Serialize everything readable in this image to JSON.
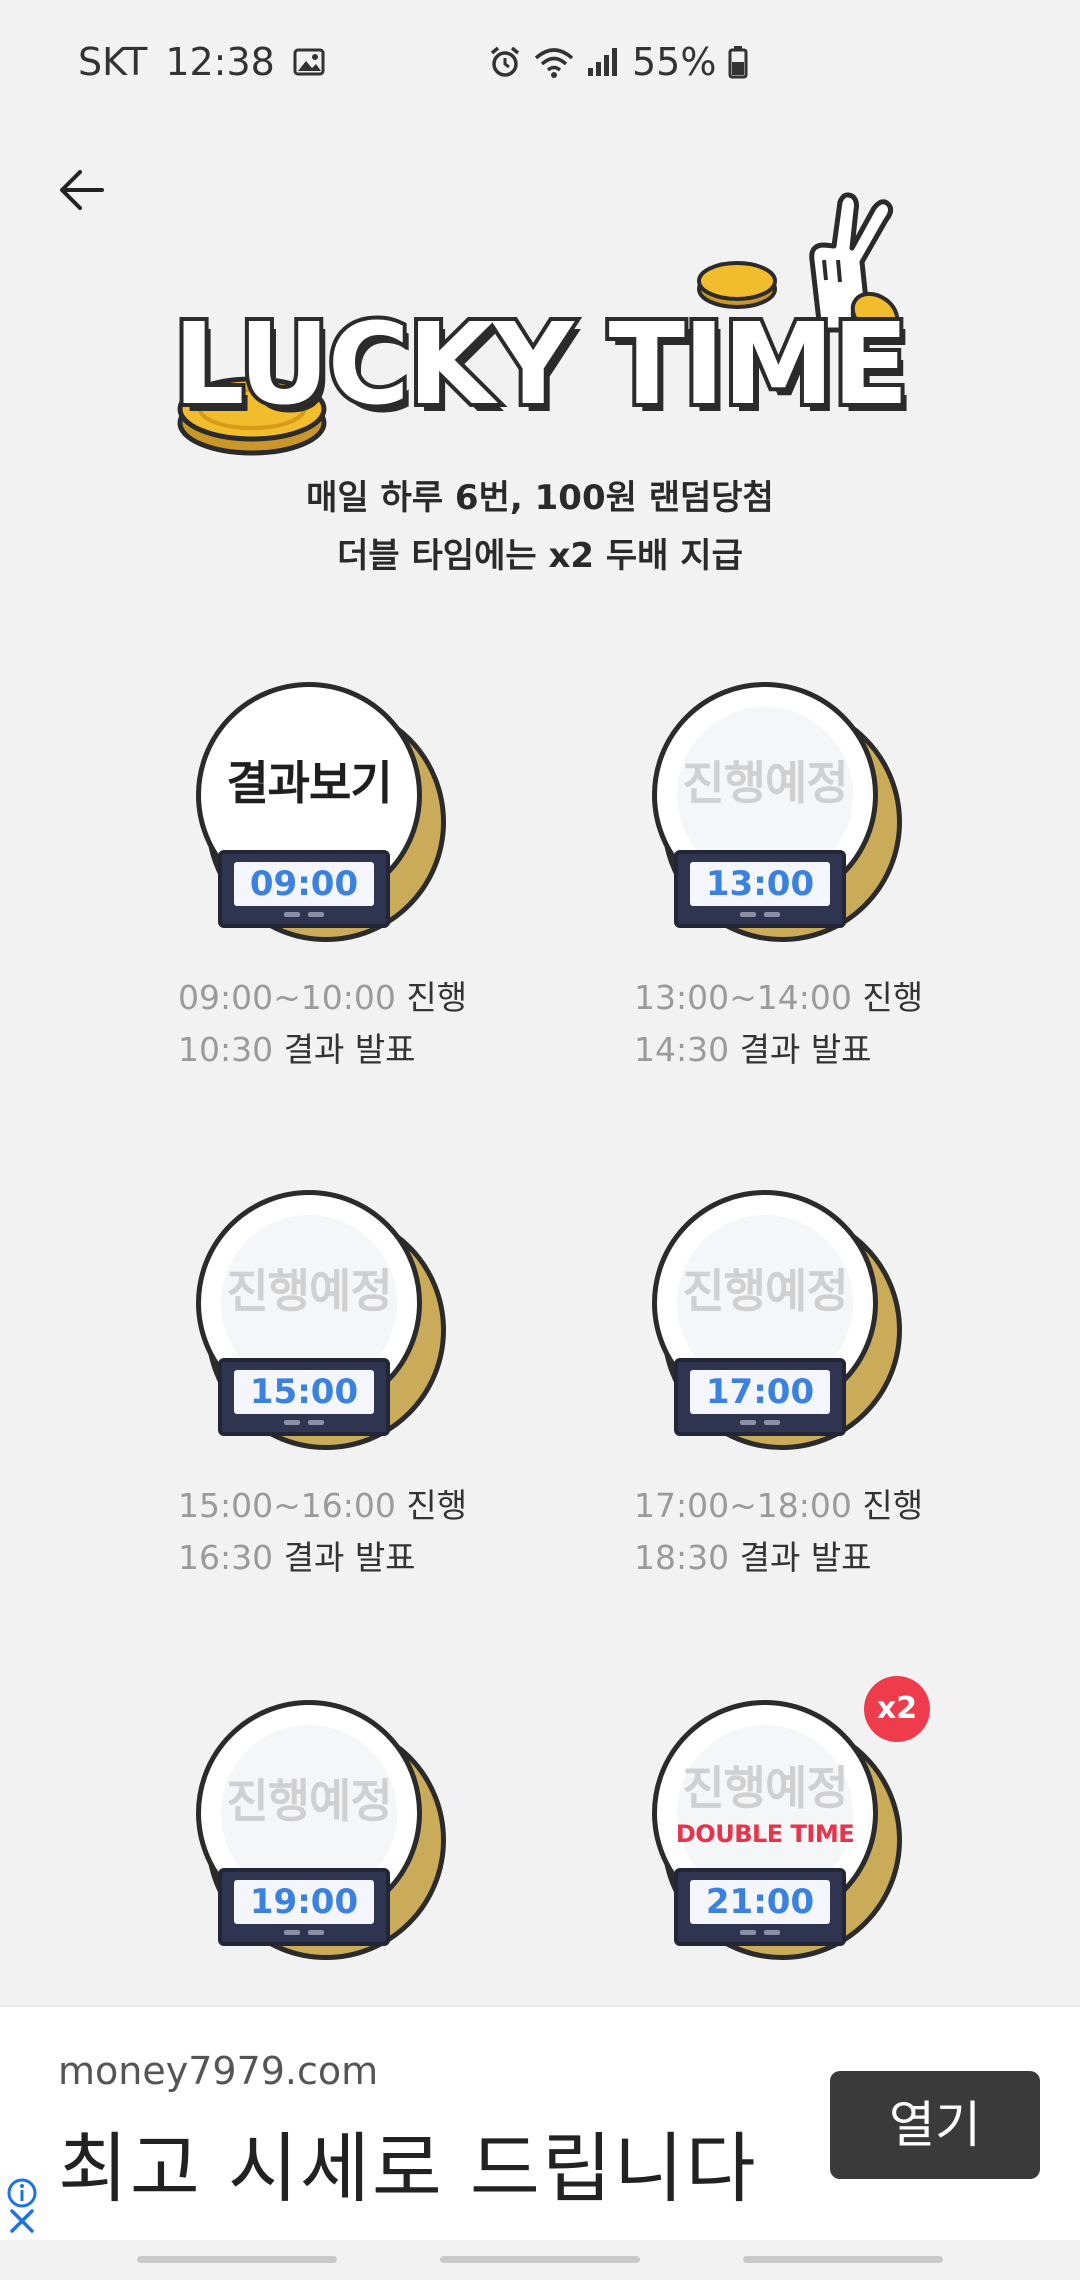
{
  "status_bar": {
    "carrier": "SKT",
    "time": "12:38",
    "battery": "55%",
    "icons": [
      "gallery-icon",
      "alarm-icon",
      "wifi-icon",
      "signal-icon",
      "battery-icon"
    ]
  },
  "header": {
    "back_icon": "arrow-left-icon",
    "title": "LUCKY TIME",
    "subtitle_line1": "매일 하루 6번, 100원 랜덤당첨",
    "subtitle_line2": "더블 타임에는 x2 두배 지급"
  },
  "slots": [
    {
      "label": "결과보기",
      "time": "09:00",
      "range": "09:00~10:00",
      "progress": "진행",
      "result_time": "10:30",
      "result_text": "결과 발표"
    },
    {
      "label": "진행예정",
      "time": "13:00",
      "range": "13:00~14:00",
      "progress": "진행",
      "result_time": "14:30",
      "result_text": "결과 발표"
    },
    {
      "label": "진행예정",
      "time": "15:00",
      "range": "15:00~16:00",
      "progress": "진행",
      "result_time": "16:30",
      "result_text": "결과 발표"
    },
    {
      "label": "진행예정",
      "time": "17:00",
      "range": "17:00~18:00",
      "progress": "진행",
      "result_time": "18:30",
      "result_text": "결과 발표"
    },
    {
      "label": "진행예정",
      "time": "19:00"
    },
    {
      "label": "진행예정",
      "time": "21:00",
      "double_label": "DOUBLE TIME",
      "badge": "x2"
    }
  ],
  "ad": {
    "domain": "money7979.com",
    "headline": "최고 시세로 드립니다",
    "button": "열기"
  },
  "colors": {
    "accent_blue": "#3b82e0",
    "badge_red": "#ef3c4d",
    "timer_navy": "#2f3550",
    "coin_gold": "#c9ab5a"
  }
}
